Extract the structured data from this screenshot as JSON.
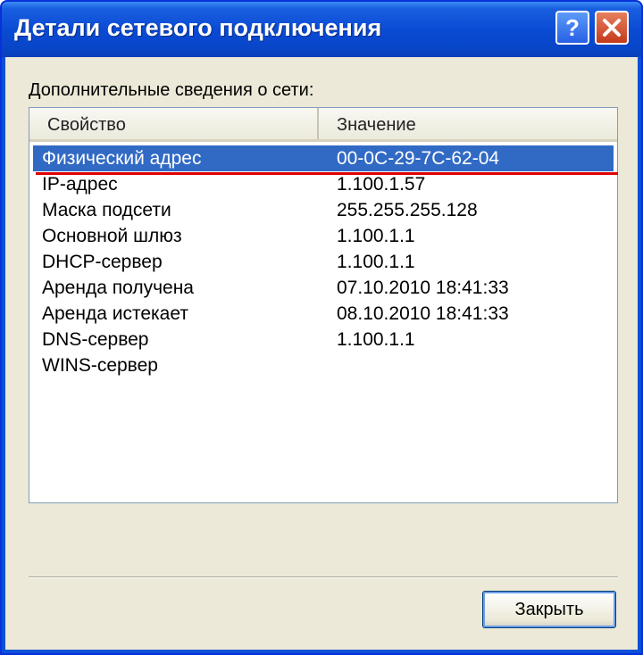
{
  "window": {
    "title": "Детали сетевого подключения",
    "help_icon": "help-icon",
    "close_icon": "close-icon"
  },
  "caption": "Дополнительные сведения о сети:",
  "table": {
    "columns": [
      "Свойство",
      "Значение"
    ],
    "rows": [
      {
        "property": "Физический адрес",
        "value": "00-0C-29-7C-62-04",
        "selected": true
      },
      {
        "property": "IP-адрес",
        "value": "1.100.1.57"
      },
      {
        "property": "Маска подсети",
        "value": "255.255.255.128"
      },
      {
        "property": "Основной шлюз",
        "value": "1.100.1.1"
      },
      {
        "property": "DHCP-сервер",
        "value": "1.100.1.1"
      },
      {
        "property": "Аренда получена",
        "value": "07.10.2010 18:41:33"
      },
      {
        "property": "Аренда истекает",
        "value": "08.10.2010 18:41:33"
      },
      {
        "property": "DNS-сервер",
        "value": "1.100.1.1"
      },
      {
        "property": "WINS-сервер",
        "value": ""
      }
    ]
  },
  "buttons": {
    "close_label": "Закрыть"
  },
  "colors": {
    "selection": "#316ac5",
    "annotation_underline": "#e00000"
  }
}
